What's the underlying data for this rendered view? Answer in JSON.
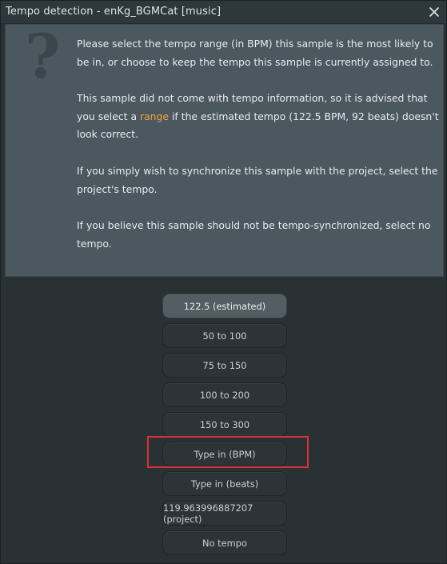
{
  "window": {
    "title": "Tempo detection - enKg_BGMCat [music]"
  },
  "message": {
    "p1": "Please select the tempo range (in BPM) this sample is the most likely to be in, or choose to keep the tempo this sample is currently assigned to.",
    "p2_before": "This sample did not come with tempo information, so it is advised that you select a ",
    "p2_link": "range",
    "p2_after": " if the estimated tempo (122.5 BPM, 92 beats) doesn't look correct.",
    "p3": "If you simply wish to synchronize this sample with the project, select the project's tempo.",
    "p4": "If you believe this sample should not be tempo-synchronized, select no tempo."
  },
  "buttons": [
    {
      "label": "122.5 (estimated)"
    },
    {
      "label": "50 to 100"
    },
    {
      "label": "75 to 150"
    },
    {
      "label": "100 to 200"
    },
    {
      "label": "150 to 300"
    },
    {
      "label": "Type in (BPM)"
    },
    {
      "label": "Type in (beats)"
    },
    {
      "label": "119.963996887207 (project)"
    },
    {
      "label": "No tempo"
    }
  ],
  "colors": {
    "accent_link": "#f0a23a",
    "highlight": "#d9303a"
  },
  "icons": {
    "question": "question-mark-icon",
    "close": "close-icon"
  }
}
